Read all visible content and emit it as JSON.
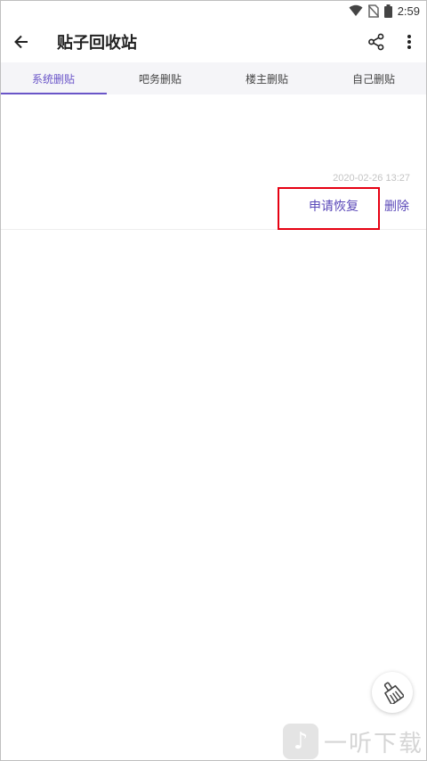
{
  "status_bar": {
    "time": "2:59"
  },
  "toolbar": {
    "title": "贴子回收站",
    "back_icon": "arrow-left-icon",
    "share_icon": "share-icon",
    "more_icon": "more-vertical-icon"
  },
  "tabs": [
    {
      "label": "系统删贴",
      "active": true
    },
    {
      "label": "吧务删贴",
      "active": false
    },
    {
      "label": "楼主删贴",
      "active": false
    },
    {
      "label": "自己删贴",
      "active": false
    }
  ],
  "post": {
    "time": "2020-02-26 13:27",
    "restore_label": "申请恢复",
    "delete_label": "删除"
  },
  "fab": {
    "icon": "broom-icon"
  },
  "watermark": {
    "text": "一听下载"
  },
  "colors": {
    "accent": "#6a55c8",
    "link": "#5a48b8",
    "highlight": "#e60012"
  }
}
